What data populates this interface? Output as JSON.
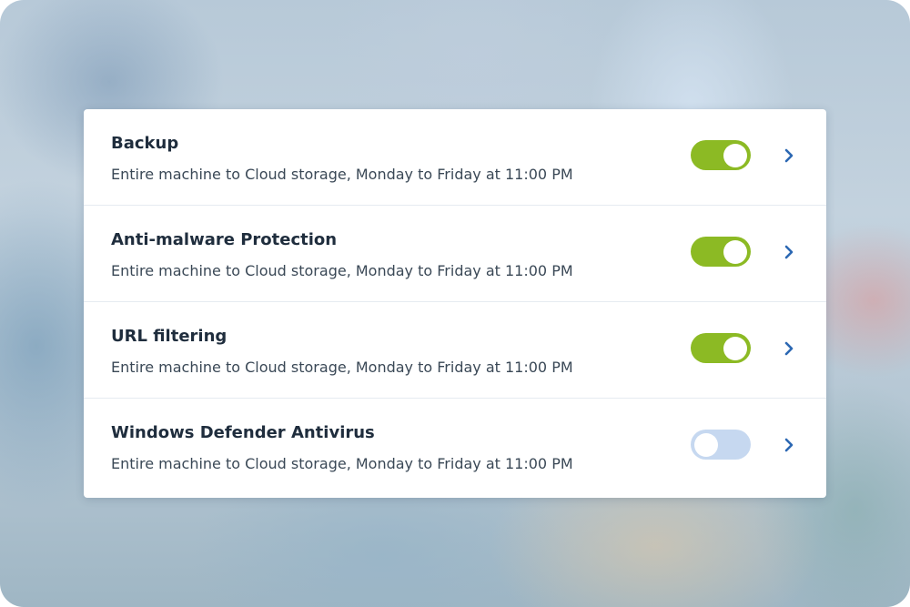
{
  "colors": {
    "toggle_on": "#8cba24",
    "toggle_off": "#c6d8f0",
    "chevron": "#2c68b3",
    "title_text": "#1f2d3d",
    "description_text": "#3a4856"
  },
  "settings": [
    {
      "title": "Backup",
      "description": "Entire machine to Cloud storage, Monday to Friday at 11:00 PM",
      "enabled": true,
      "icon": "chevron-right-icon"
    },
    {
      "title": "Anti-malware Protection",
      "description": "Entire machine to Cloud storage, Monday to Friday at 11:00 PM",
      "enabled": true,
      "icon": "chevron-right-icon"
    },
    {
      "title": "URL filtering",
      "description": "Entire machine to Cloud storage, Monday to Friday at 11:00 PM",
      "enabled": true,
      "icon": "chevron-right-icon"
    },
    {
      "title": "Windows Defender Antivirus",
      "description": "Entire machine to Cloud storage, Monday to Friday at 11:00 PM",
      "enabled": false,
      "icon": "chevron-right-icon"
    }
  ]
}
